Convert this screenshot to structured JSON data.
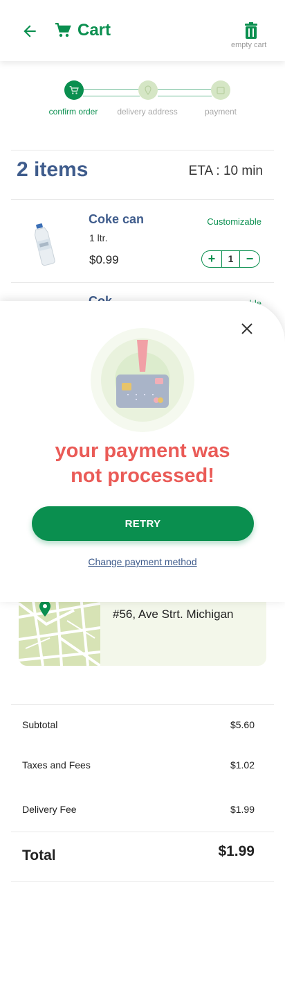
{
  "header": {
    "title": "Cart",
    "empty_label": "empty cart"
  },
  "stepper": {
    "steps": [
      {
        "label": "confirm order",
        "state": "active"
      },
      {
        "label": "delivery address",
        "state": "pending"
      },
      {
        "label": "payment",
        "state": "pending"
      }
    ]
  },
  "items": {
    "count_label": "2 items",
    "eta": "ETA : 10 min"
  },
  "products": [
    {
      "name": "Coke can",
      "size": "1 ltr.",
      "price": "$0.99",
      "custom": "Customizable",
      "qty": "1",
      "plus": "+",
      "minus": "−"
    },
    {
      "name": "Cok",
      "custom": "ble"
    }
  ],
  "modal": {
    "message_line1": "your payment was",
    "message_line2": "not processed!",
    "retry_label": "RETRY",
    "change_label": "Change payment method"
  },
  "address": {
    "text": "#56, Ave Strt. Michigan"
  },
  "summary": {
    "subtotal_label": "Subtotal",
    "subtotal_value": "$5.60",
    "taxes_label": "Taxes and Fees",
    "taxes_value": "$1.02",
    "delivery_label": "Delivery Fee",
    "delivery_value": "$1.99",
    "total_label": "Total",
    "total_value": "$1.99"
  },
  "colors": {
    "brand": "#0a8f4f",
    "title_blue": "#3f5c8c",
    "error": "#ea5b57"
  }
}
